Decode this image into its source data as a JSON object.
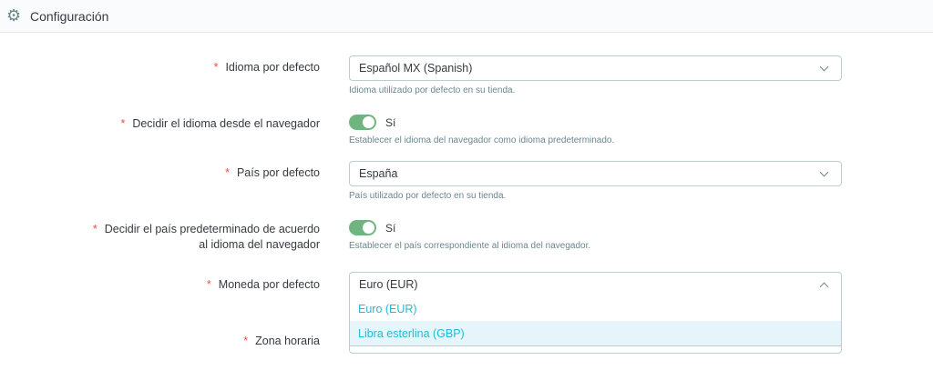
{
  "header": {
    "title": "Configuración",
    "icon": "gear-icon"
  },
  "fields": {
    "language": {
      "label": "Idioma por defecto",
      "value": "Español MX (Spanish)",
      "help": "Idioma utilizado por defecto en su tienda."
    },
    "browser_language": {
      "label": "Decidir el idioma desde el navegador",
      "value": "Sí",
      "help": "Establecer el idioma del navegador como idioma predeterminado."
    },
    "country": {
      "label": "País por defecto",
      "value": "España",
      "help": "País utilizado por defecto en su tienda."
    },
    "browser_country": {
      "label_line1": "Decidir el país predeterminado de acuerdo",
      "label_line2": "al idioma del navegador",
      "value": "Sí",
      "help": "Establecer el país correspondiente al idioma del navegador."
    },
    "currency": {
      "label": "Moneda por defecto",
      "value": "Euro (EUR)",
      "options": [
        "Euro (EUR)",
        "Libra esterlina (GBP)"
      ]
    },
    "timezone": {
      "label": "Zona horaria"
    }
  },
  "required_mark": "*"
}
